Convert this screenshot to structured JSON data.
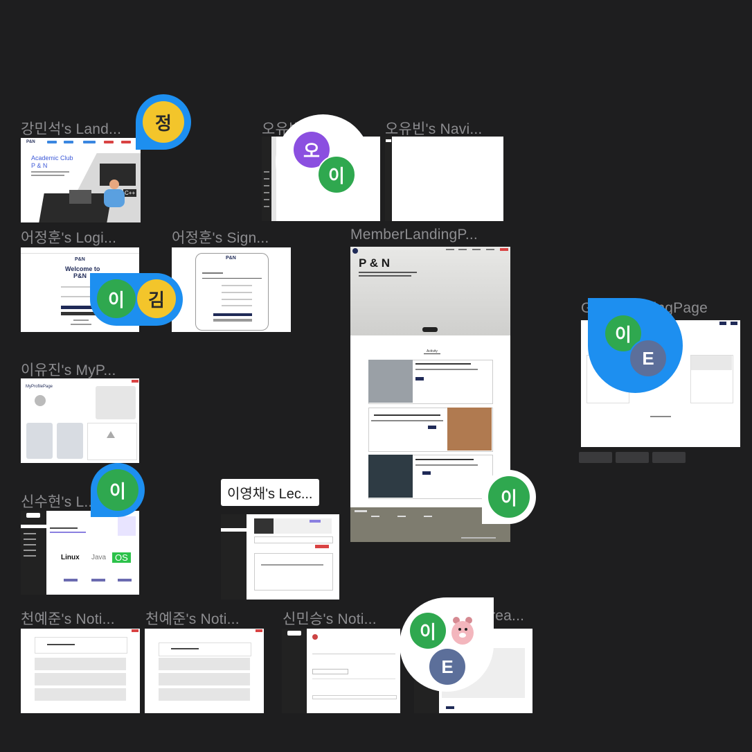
{
  "frames": {
    "kang": {
      "label": "강민석's Land...",
      "title": "Academic Club",
      "subtitle": "P & N",
      "logo": "P&N",
      "code_tag": "C++"
    },
    "oh_nav1": {
      "label": "오유빈's Navi..."
    },
    "oh_nav2": {
      "label": "오유빈's Navi..."
    },
    "eo_login": {
      "label": "어정훈's Logi...",
      "heading1": "Welcome to",
      "heading2": "P&N",
      "logo": "P&N"
    },
    "eo_signup": {
      "label": "어정훈's Sign...",
      "logo": "P&N"
    },
    "member_landing": {
      "label": "MemberLandingP...",
      "hero_title": "P & N",
      "section_tab": "Activity"
    },
    "guest_landing": {
      "label": "GuestLandingPage"
    },
    "lee_mypage": {
      "label": "이유진's MyP...",
      "title": "MyProfilePage"
    },
    "shin_l": {
      "label": "신수현's L...",
      "tag_linux": "Linux",
      "tag_java": "Java",
      "tag_os": "OS"
    },
    "lee_lec": {
      "label": "이영채's Lec..."
    },
    "cheon_noti1": {
      "label": "천예준's Noti..."
    },
    "cheon_noti2": {
      "label": "천예준's Noti..."
    },
    "shin_noti": {
      "label": "신민승's Noti..."
    },
    "crea": {
      "label": "...rea..."
    }
  },
  "cursors": {
    "jeong": "정",
    "oh": "오",
    "lee": "이",
    "kim": "김",
    "e": "E"
  },
  "colors": {
    "canvas": "#1e1e1f",
    "cursor_blue": "#1d8ff0",
    "green": "#2fa84f",
    "yellow": "#f3c52b",
    "purple": "#8b4fe0",
    "slate": "#5c6f9a",
    "footer_olive": "#7e7c6f",
    "brand_navy": "#1f2a57"
  }
}
